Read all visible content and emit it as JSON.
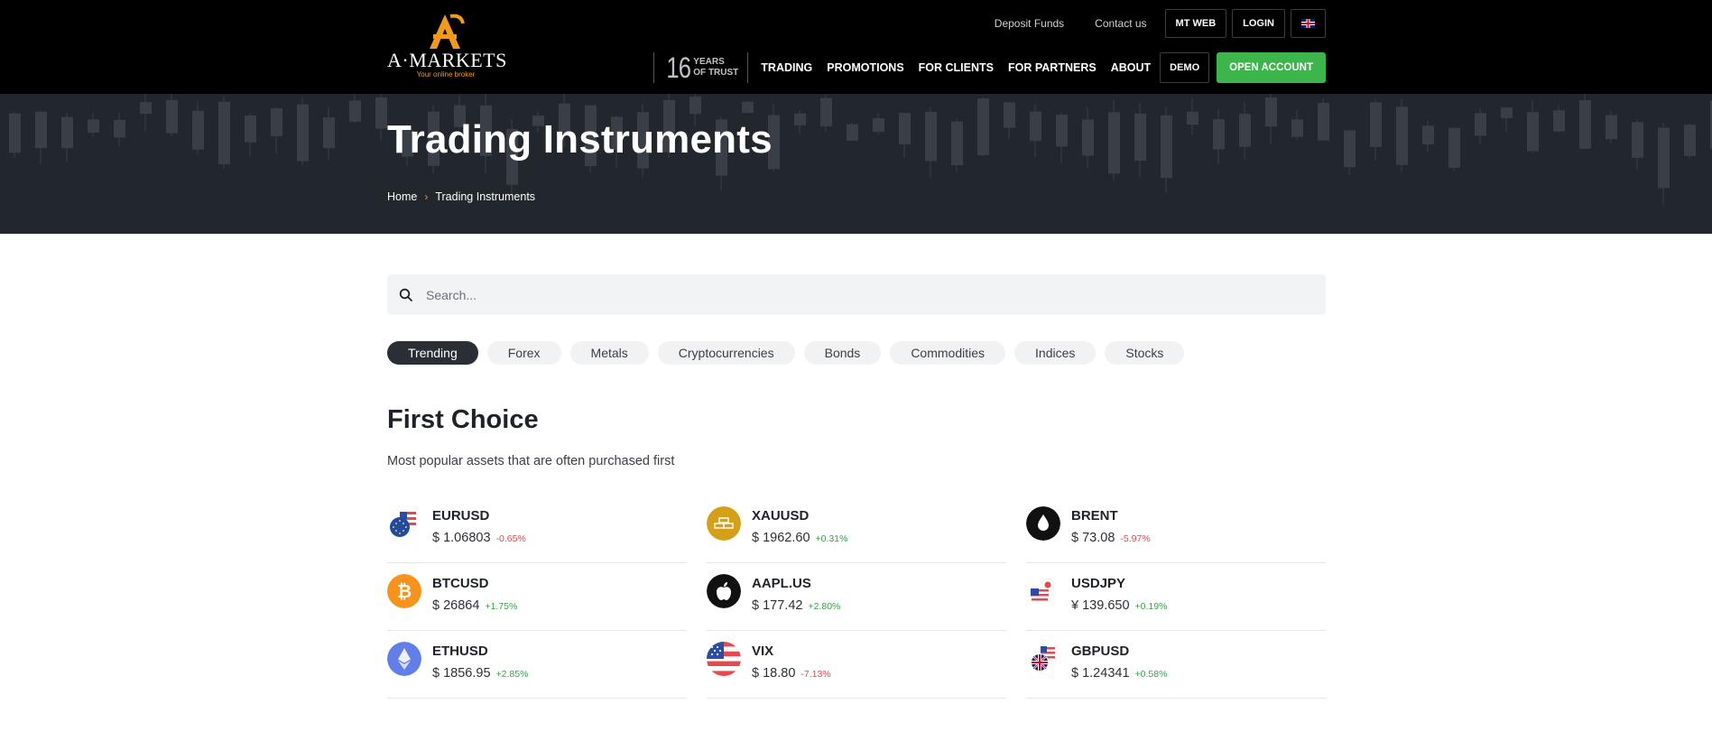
{
  "header": {
    "logo_text": "A·MARKETS",
    "logo_tagline": "Your online broker",
    "top_links": {
      "deposit": "Deposit Funds",
      "contact": "Contact us",
      "mtweb": "MT WEB",
      "login": "LOGIN"
    },
    "trust": {
      "number": "16",
      "line1": "YEARS",
      "line2": "OF TRUST"
    },
    "nav": {
      "trading": "TRADING",
      "promotions": "PROMOTIONS",
      "clients": "FOR CLIENTS",
      "partners": "FOR PARTNERS",
      "about": "ABOUT"
    },
    "demo_label": "DEMO",
    "open_account_label": "OPEN ACCOUNT"
  },
  "hero": {
    "title": "Trading Instruments",
    "breadcrumb": {
      "home": "Home",
      "sep": "›",
      "current": "Trading Instruments"
    }
  },
  "search": {
    "placeholder": "Search..."
  },
  "categories": [
    "Trending",
    "Forex",
    "Metals",
    "Cryptocurrencies",
    "Bonds",
    "Commodities",
    "Indices",
    "Stocks"
  ],
  "section": {
    "title": "First Choice",
    "subtitle": "Most popular assets that are often purchased first"
  },
  "assets": [
    {
      "name": "EURUSD",
      "price": "$ 1.06803",
      "change": "-0.65%"
    },
    {
      "name": "XAUUSD",
      "price": "$ 1962.60",
      "change": "+0.31%"
    },
    {
      "name": "BRENT",
      "price": "$ 73.08",
      "change": "-5.97%"
    },
    {
      "name": "BTCUSD",
      "price": "$ 26864",
      "change": "+1.75%"
    },
    {
      "name": "AAPL.US",
      "price": "$ 177.42",
      "change": "+2.80%"
    },
    {
      "name": "USDJPY",
      "price": "¥ 139.650",
      "change": "+0.19%"
    },
    {
      "name": "ETHUSD",
      "price": "$ 1856.95",
      "change": "+2.85%"
    },
    {
      "name": "VIX",
      "price": "$ 18.80",
      "change": "-7.13%"
    },
    {
      "name": "GBPUSD",
      "price": "$ 1.24341",
      "change": "+0.58%"
    }
  ],
  "colors": {
    "accent_orange": "#f39a1b",
    "open_account_green": "#3cb54a",
    "up": "#37a34a",
    "down": "#e5484d",
    "hero_bg": "#22262d"
  }
}
